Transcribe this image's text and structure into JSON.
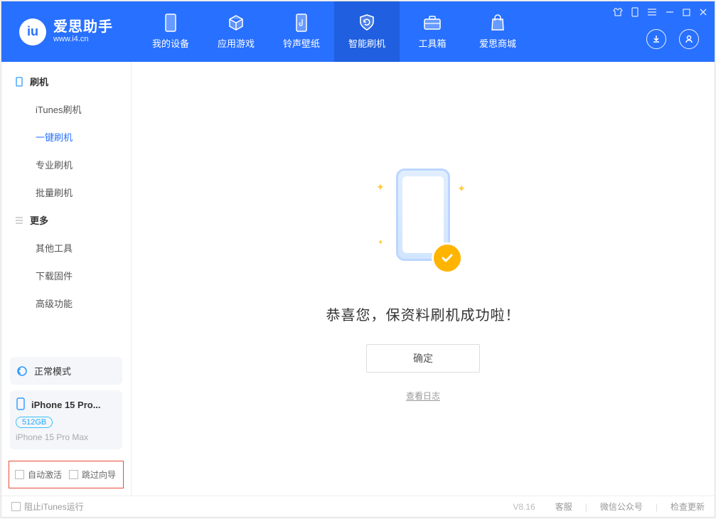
{
  "app": {
    "title": "爱思助手",
    "subtitle": "www.i4.cn"
  },
  "nav": [
    {
      "key": "device",
      "label": "我的设备"
    },
    {
      "key": "apps",
      "label": "应用游戏"
    },
    {
      "key": "ringtone",
      "label": "铃声壁纸"
    },
    {
      "key": "flash",
      "label": "智能刷机"
    },
    {
      "key": "toolbox",
      "label": "工具箱"
    },
    {
      "key": "store",
      "label": "爱思商城"
    }
  ],
  "sidebar": {
    "group_flash": "刷机",
    "items_flash": [
      {
        "label": "iTunes刷机"
      },
      {
        "label": "一键刷机",
        "active": true
      },
      {
        "label": "专业刷机"
      },
      {
        "label": "批量刷机"
      }
    ],
    "group_more": "更多",
    "items_more": [
      {
        "label": "其他工具"
      },
      {
        "label": "下载固件"
      },
      {
        "label": "高级功能"
      }
    ],
    "status": "正常模式",
    "device": {
      "name": "iPhone 15 Pro...",
      "storage": "512GB",
      "model": "iPhone 15 Pro Max"
    },
    "options": {
      "auto_activate": "自动激活",
      "skip_guide": "跳过向导"
    }
  },
  "main": {
    "success_text": "恭喜您，保资料刷机成功啦！",
    "ok_button": "确定",
    "view_log": "查看日志"
  },
  "footer": {
    "block_itunes": "阻止iTunes运行",
    "version": "V8.16",
    "support": "客服",
    "wechat": "微信公众号",
    "check_update": "检查更新"
  }
}
